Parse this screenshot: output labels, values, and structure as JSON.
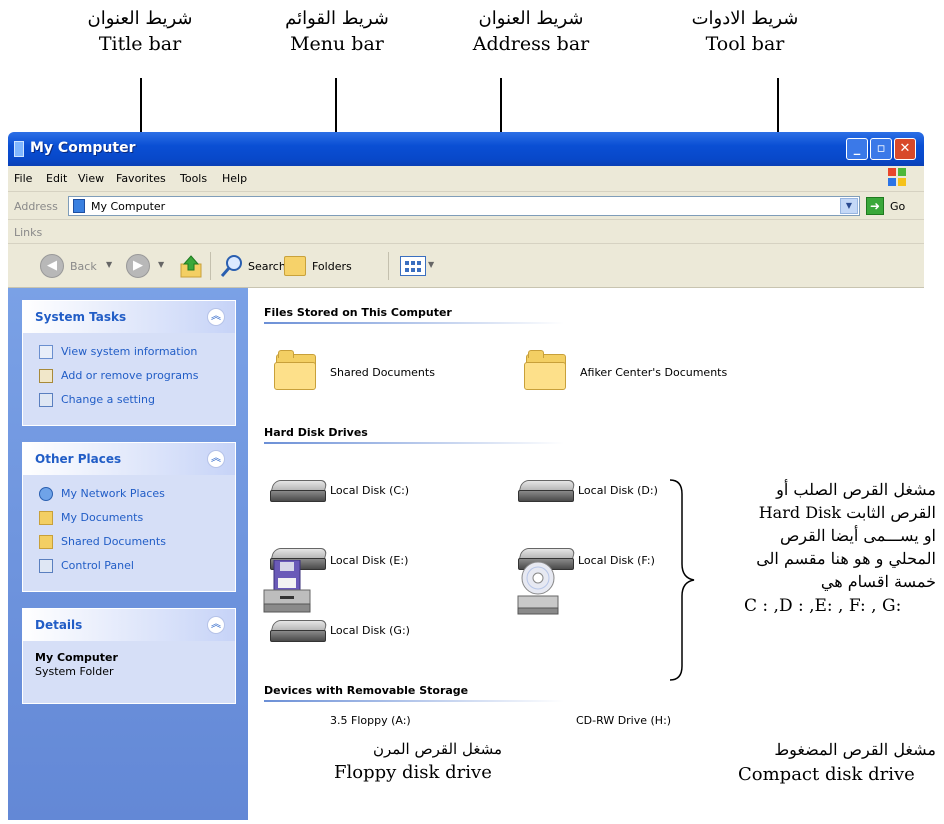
{
  "annotations": {
    "title_bar": {
      "ar": "شريط العنوان",
      "en": "Title bar"
    },
    "menu_bar": {
      "ar": "شريط القوائم",
      "en": "Menu  bar"
    },
    "address_bar": {
      "ar": "شريط العنوان",
      "en": "Address  bar"
    },
    "tool_bar": {
      "ar": "شريط الادوات",
      "en": "Tool  bar"
    },
    "hard_disk": {
      "line1": "مشغل القرص الصلب أو",
      "line2": "القرص الثابت Hard Disk",
      "line3": "او يســـمى أيضا القرص",
      "line4": "المحلي و هو هنا مقسم الى",
      "line5": "خمسة اقسام هي",
      "line6": "C : ,D : ,E:  , F: , G:"
    },
    "floppy": {
      "ar": "مشغل القرص المرن",
      "en": "Floppy  disk  drive"
    },
    "cd": {
      "ar": "مشغل القرص المضغوط",
      "en": "Compact disk  drive"
    }
  },
  "window": {
    "title": "My Computer",
    "controls": {
      "minimize": "_",
      "maximize": "▫",
      "close": "✕"
    }
  },
  "menu": [
    "File",
    "Edit",
    "View",
    "Favorites",
    "Tools",
    "Help"
  ],
  "address": {
    "label": "Address",
    "value": "My Computer",
    "go": "Go"
  },
  "links": {
    "label": "Links"
  },
  "toolbar": {
    "back": "Back",
    "search": "Search",
    "folders": "Folders"
  },
  "left_pane": {
    "system_tasks": {
      "title": "System Tasks",
      "items": [
        "View system information",
        "Add or remove programs",
        "Change a setting"
      ]
    },
    "other_places": {
      "title": "Other Places",
      "items": [
        "My Network Places",
        "My Documents",
        "Shared Documents",
        "Control Panel"
      ]
    },
    "details": {
      "title": "Details",
      "name": "My Computer",
      "type": "System Folder"
    }
  },
  "content": {
    "files_stored": {
      "title": "Files Stored on This Computer",
      "items": [
        "Shared Documents",
        "Afiker Center's Documents"
      ]
    },
    "hard_disks": {
      "title": "Hard Disk Drives",
      "items": [
        "Local Disk (C:)",
        "Local Disk (D:)",
        "Local Disk (E:)",
        "Local Disk (F:)",
        "Local Disk (G:)"
      ]
    },
    "removable": {
      "title": "Devices with Removable Storage",
      "items": [
        "3.5 Floppy (A:)",
        "CD-RW Drive (H:)"
      ]
    }
  },
  "colors": {
    "title_bar": "#0a4fd4",
    "task_pane": "#6e97e0",
    "link_text": "#215dc6"
  }
}
